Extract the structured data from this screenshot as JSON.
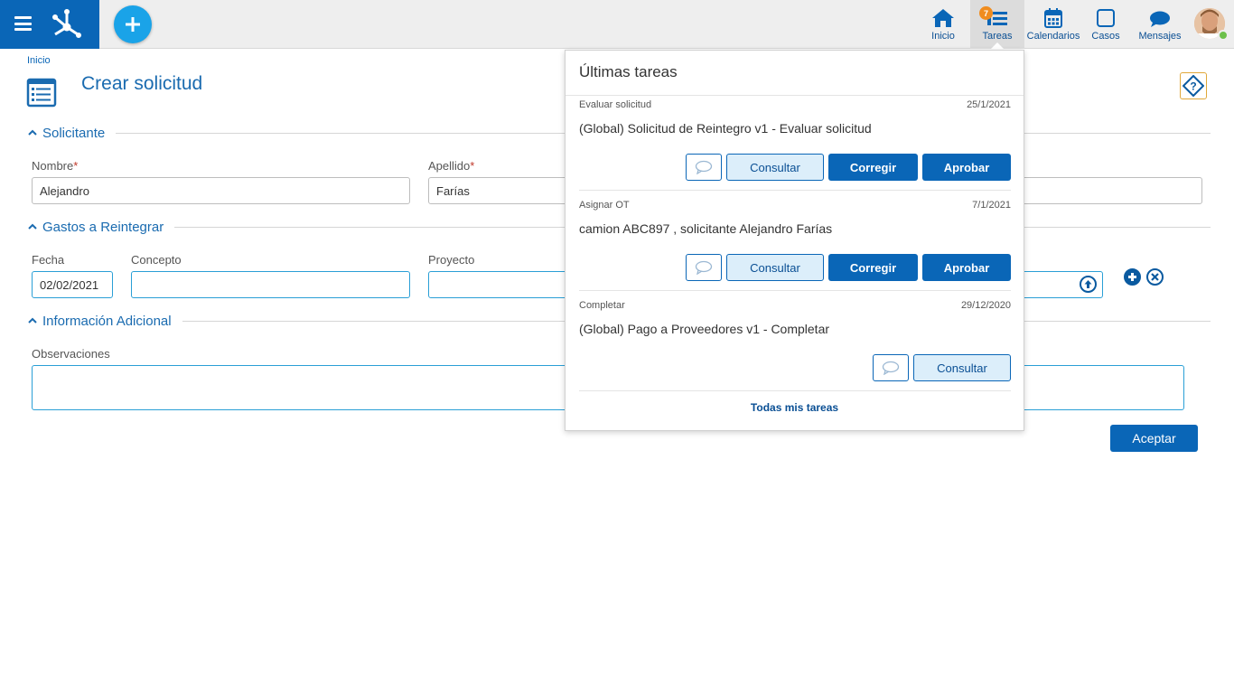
{
  "topbar": {
    "nav": [
      {
        "label": "Inicio",
        "icon": "home-icon"
      },
      {
        "label": "Tareas",
        "icon": "tasks-icon",
        "badge": "7"
      },
      {
        "label": "Calendarios",
        "icon": "calendar-icon"
      },
      {
        "label": "Casos",
        "icon": "case-icon"
      },
      {
        "label": "Mensajes",
        "icon": "message-icon"
      }
    ]
  },
  "page": {
    "breadcrumb": "Inicio",
    "title": "Crear solicitud"
  },
  "form": {
    "sections": [
      {
        "title": "Solicitante"
      },
      {
        "title": "Gastos a Reintegrar"
      },
      {
        "title": "Información Adicional"
      }
    ],
    "nombre_label": "Nombre",
    "nombre_value": "Alejandro",
    "apellido_label": "Apellido",
    "apellido_value": "Farías",
    "required_mark": "*",
    "fecha_label": "Fecha",
    "fecha_value": "02/02/2021",
    "concepto_label": "Concepto",
    "concepto_value": "",
    "proyecto_label": "Proyecto",
    "proyecto_value": "",
    "observaciones_label": "Observaciones",
    "observaciones_value": "",
    "accept_label": "Aceptar"
  },
  "tasks_panel": {
    "title": "Últimas tareas",
    "tasks": [
      {
        "name": "Evaluar solicitud",
        "date": "25/1/2021",
        "description": "(Global) Solicitud de Reintegro v1 - Evaluar solicitud",
        "consultar": "Consultar",
        "corregir": "Corregir",
        "aprobar": "Aprobar"
      },
      {
        "name": "Asignar OT",
        "date": "7/1/2021",
        "description": "camion ABC897 , solicitante Alejandro Farías",
        "consultar": "Consultar",
        "corregir": "Corregir",
        "aprobar": "Aprobar"
      },
      {
        "name": "Completar",
        "date": "29/12/2020",
        "description": "(Global) Pago a Proveedores v1 - Completar",
        "consultar": "Consultar"
      }
    ],
    "all_tasks_label": "Todas mis tareas"
  },
  "colors": {
    "brand": "#0a66b7",
    "accent": "#1aa3e8",
    "badge": "#f08c1e",
    "online": "#6cc04a"
  }
}
